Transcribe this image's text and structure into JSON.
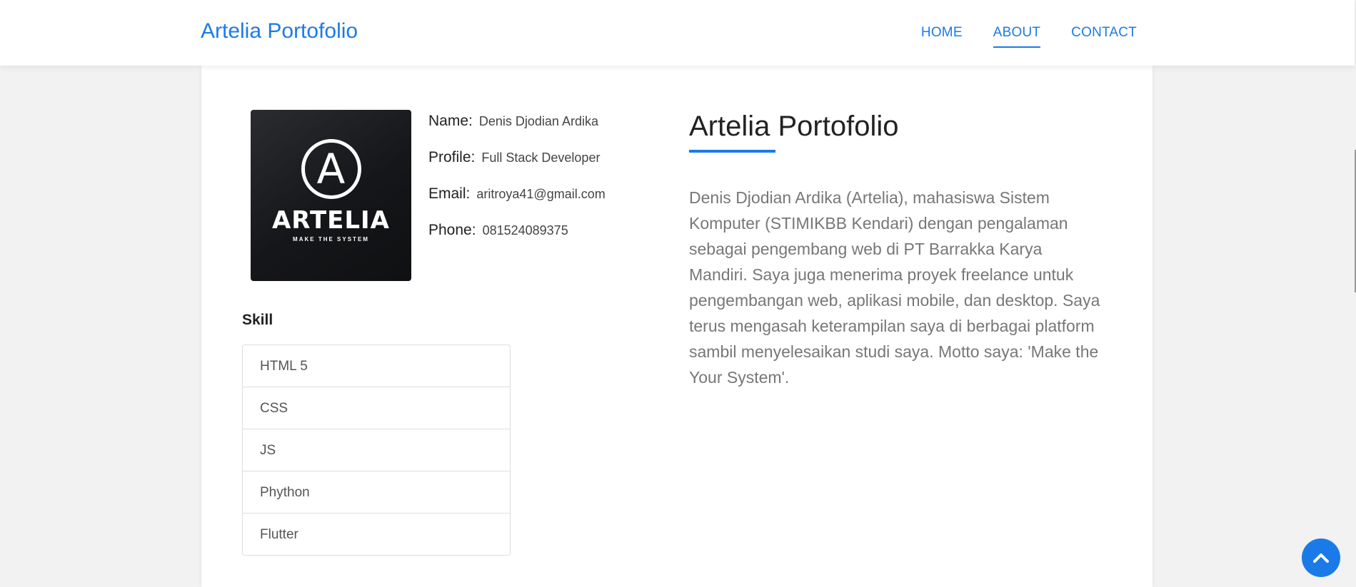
{
  "header": {
    "brand": "Artelia Portofolio",
    "nav": [
      "HOME",
      "ABOUT",
      "CONTACT"
    ],
    "active_nav": "ABOUT"
  },
  "profile": {
    "logo_word": "ARTELIA",
    "logo_tagline": "MAKE THE SYSTEM",
    "fields": [
      {
        "label": "Name:",
        "value": "Denis Djodian Ardika"
      },
      {
        "label": "Profile:",
        "value": "Full Stack Developer"
      },
      {
        "label": "Email:",
        "value": "aritroya41@gmail.com"
      },
      {
        "label": "Phone:",
        "value": "081524089375"
      }
    ]
  },
  "skills": {
    "title": "Skill",
    "items": [
      "HTML 5",
      "CSS",
      "JS",
      "Phython",
      "Flutter"
    ]
  },
  "about": {
    "title": "Artelia Portofolio",
    "text": "Denis Djodian Ardika (Artelia), mahasiswa Sistem Komputer (STIMIKBB Kendari) dengan pengalaman sebagai pengembang web di PT Barrakka Karya Mandiri. Saya juga menerima proyek freelance untuk pengembangan web, aplikasi mobile, dan desktop. Saya terus mengasah keterampilan saya di berbagai platform sambil menyelesaikan studi saya. Motto saya: 'Make the Your System'."
  },
  "icons": {
    "back_to_top": "chevron-up-icon"
  },
  "colors": {
    "accent": "#1a7be8",
    "background": "#f2f2f2"
  }
}
